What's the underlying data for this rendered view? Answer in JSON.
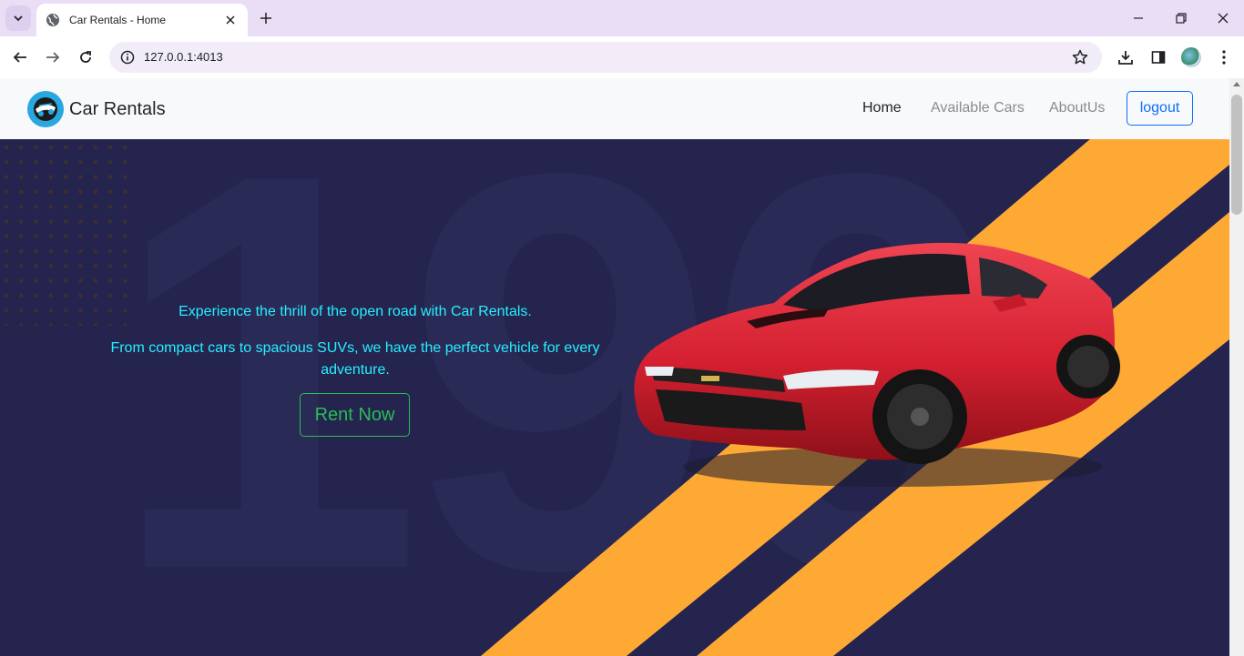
{
  "browser": {
    "tab_title": "Car Rentals - Home",
    "url": "127.0.0.1:4013"
  },
  "navbar": {
    "brand": "Car Rentals",
    "links": [
      {
        "label": "Home",
        "active": true
      },
      {
        "label": "Available Cars",
        "active": false
      },
      {
        "label": "AboutUs",
        "active": false
      }
    ],
    "logout_label": "logout"
  },
  "hero": {
    "line1": "Experience the thrill of the open road with Car Rentals.",
    "line2": "From compact cars to spacious SUVs, we have the perfect vehicle for every adventure.",
    "button_label": "Rent Now",
    "background_numerals": "190"
  },
  "colors": {
    "hero_bg": "#24244f",
    "stripe": "#ffa935",
    "hero_text": "#26f0ff",
    "button": "#2bbd55",
    "logout": "#0d6efd",
    "car_body": "#d42030"
  },
  "icons": [
    "tab-list-icon",
    "globe-icon",
    "close-icon",
    "plus-icon",
    "minimize-icon",
    "restore-icon",
    "back-icon",
    "forward-icon",
    "reload-icon",
    "info-icon",
    "star-icon",
    "download-icon",
    "sidebar-icon",
    "more-icon"
  ]
}
